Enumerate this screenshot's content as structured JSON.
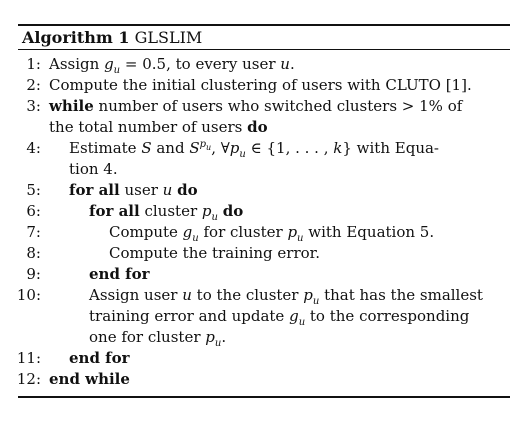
{
  "algorithm": {
    "label": "Algorithm 1",
    "name": "GLSLIM"
  },
  "steps": {
    "s1": {
      "num": "1:",
      "text": "Assign gu = 0.5, to every user u."
    },
    "s2": {
      "num": "2:",
      "text": "Compute the initial clustering of users with CLUTO [1]."
    },
    "s3": {
      "num": "3:",
      "kw": "while",
      "text": "number of users who switched clusters > 1% of",
      "cont": "the total number of users",
      "kw_end": "do"
    },
    "s4": {
      "num": "4:",
      "text": "Estimate S and S^pu, ∀pu ∈ {1, . . . , k} with Equa-",
      "cont": "tion 4."
    },
    "s5": {
      "num": "5:",
      "kw": "for all",
      "text": "user u",
      "kw_end": "do"
    },
    "s6": {
      "num": "6:",
      "kw": "for all",
      "text": "cluster pu",
      "kw_end": "do"
    },
    "s7": {
      "num": "7:",
      "text": "Compute gu for cluster pu with Equation 5."
    },
    "s8": {
      "num": "8:",
      "text": "Compute the training error."
    },
    "s9": {
      "num": "9:",
      "kw": "end for"
    },
    "s10": {
      "num": "10:",
      "text": "Assign user u to the cluster pu that has the smallest",
      "cont1": "training error and update gu to the corresponding",
      "cont2": "one for cluster pu."
    },
    "s11": {
      "num": "11:",
      "kw": "end for"
    },
    "s12": {
      "num": "12:",
      "kw": "end while"
    }
  }
}
